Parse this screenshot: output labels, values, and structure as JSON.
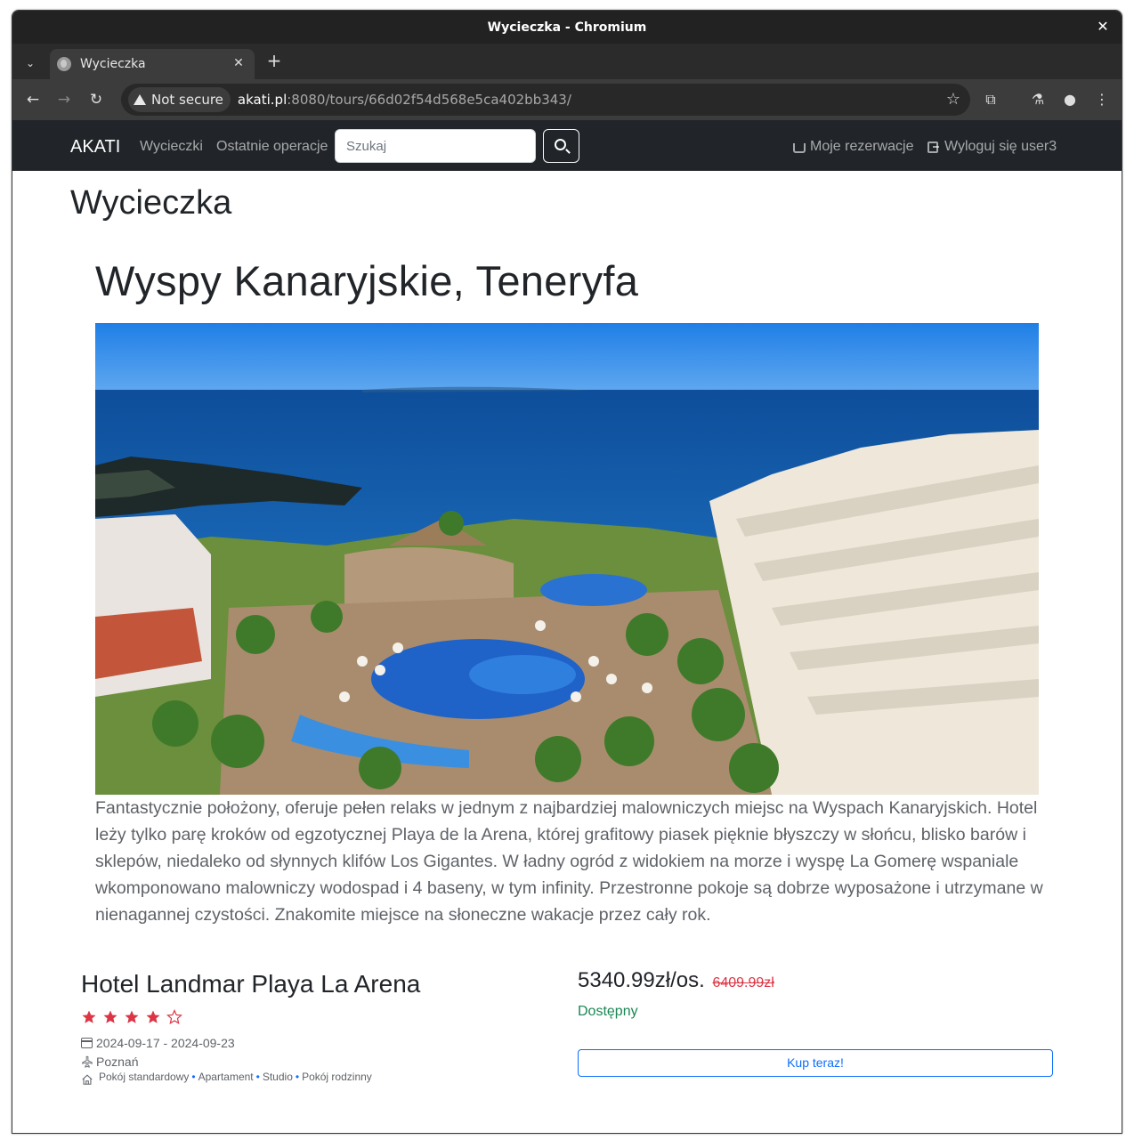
{
  "browser": {
    "window_title": "Wycieczka - Chromium",
    "tab_title": "Wycieczka",
    "security_label": "Not secure",
    "url_host": "akati.pl",
    "url_rest": ":8080/tours/66d02f54d568e5ca402bb343/"
  },
  "navbar": {
    "brand": "AKATI",
    "links": [
      "Wycieczki",
      "Ostatnie operacje"
    ],
    "search_placeholder": "Szukaj",
    "reservations_label": "Moje rezerwacje",
    "logout_label": "Wyloguj się user3"
  },
  "page": {
    "heading": "Wycieczka",
    "tour_title": "Wyspy Kanaryjskie, Teneryfa",
    "description": "Fantastycznie położony, oferuje pełen relaks w jednym z najbardziej malowniczych miejsc na Wyspach Kanaryjskich. Hotel leży tylko parę kroków od egzotycznej Playa de la Arena, której grafitowy piasek pięknie błyszczy w słońcu, blisko barów i sklepów, niedaleko od słynnych klifów Los Gigantes. W ładny ogród z widokiem na morze i wyspę La Gomerę wspaniale wkomponowano malowniczy wodospad i 4 baseny, w tym infinity. Przestronne pokoje są dobrze wyposażone i utrzymane w nienagannej czystości. Znakomite miejsce na słoneczne wakacje przez cały rok."
  },
  "hotel": {
    "name": "Hotel Landmar Playa La Arena",
    "rating": 4,
    "max_rating": 5,
    "dates": "2024-09-17 - 2024-09-23",
    "departure": "Poznań",
    "rooms": [
      "Pokój standardowy",
      "Apartament",
      "Studio",
      "Pokój rodzinny"
    ]
  },
  "offer": {
    "price": "5340.99zł/os.",
    "old_price": "6409.99zł",
    "availability": "Dostępny",
    "buy_label": "Kup teraz!"
  },
  "colors": {
    "navbar_bg": "#212529",
    "star": "#dc3545",
    "available": "#198754",
    "old_price": "#dc3545",
    "primary": "#0d6efd"
  }
}
